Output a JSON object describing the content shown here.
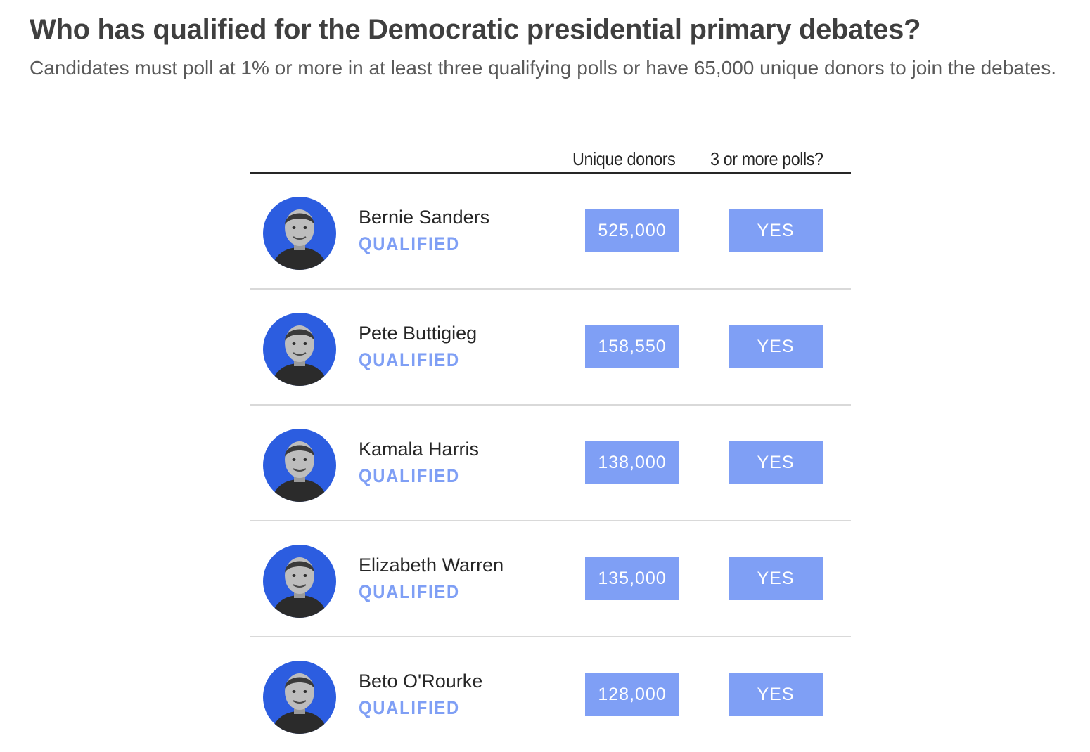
{
  "title": "Who has qualified for the Democratic presidential primary debates?",
  "subtitle": "Candidates must poll at 1% or more in at least three qualifying polls or have 65,000 unique donors to join the debates.",
  "columns": {
    "donors": "Unique donors",
    "polls": "3 or more polls?"
  },
  "colors": {
    "accent": "#7f9ff5",
    "status_text": "#7f9ff5",
    "avatar_bg": "#2c5de0"
  },
  "candidates": [
    {
      "name": "Bernie Sanders",
      "status": "QUALIFIED",
      "donors": "525,000",
      "polls": "YES"
    },
    {
      "name": "Pete Buttigieg",
      "status": "QUALIFIED",
      "donors": "158,550",
      "polls": "YES"
    },
    {
      "name": "Kamala Harris",
      "status": "QUALIFIED",
      "donors": "138,000",
      "polls": "YES"
    },
    {
      "name": "Elizabeth Warren",
      "status": "QUALIFIED",
      "donors": "135,000",
      "polls": "YES"
    },
    {
      "name": "Beto O'Rourke",
      "status": "QUALIFIED",
      "donors": "128,000",
      "polls": "YES"
    }
  ]
}
